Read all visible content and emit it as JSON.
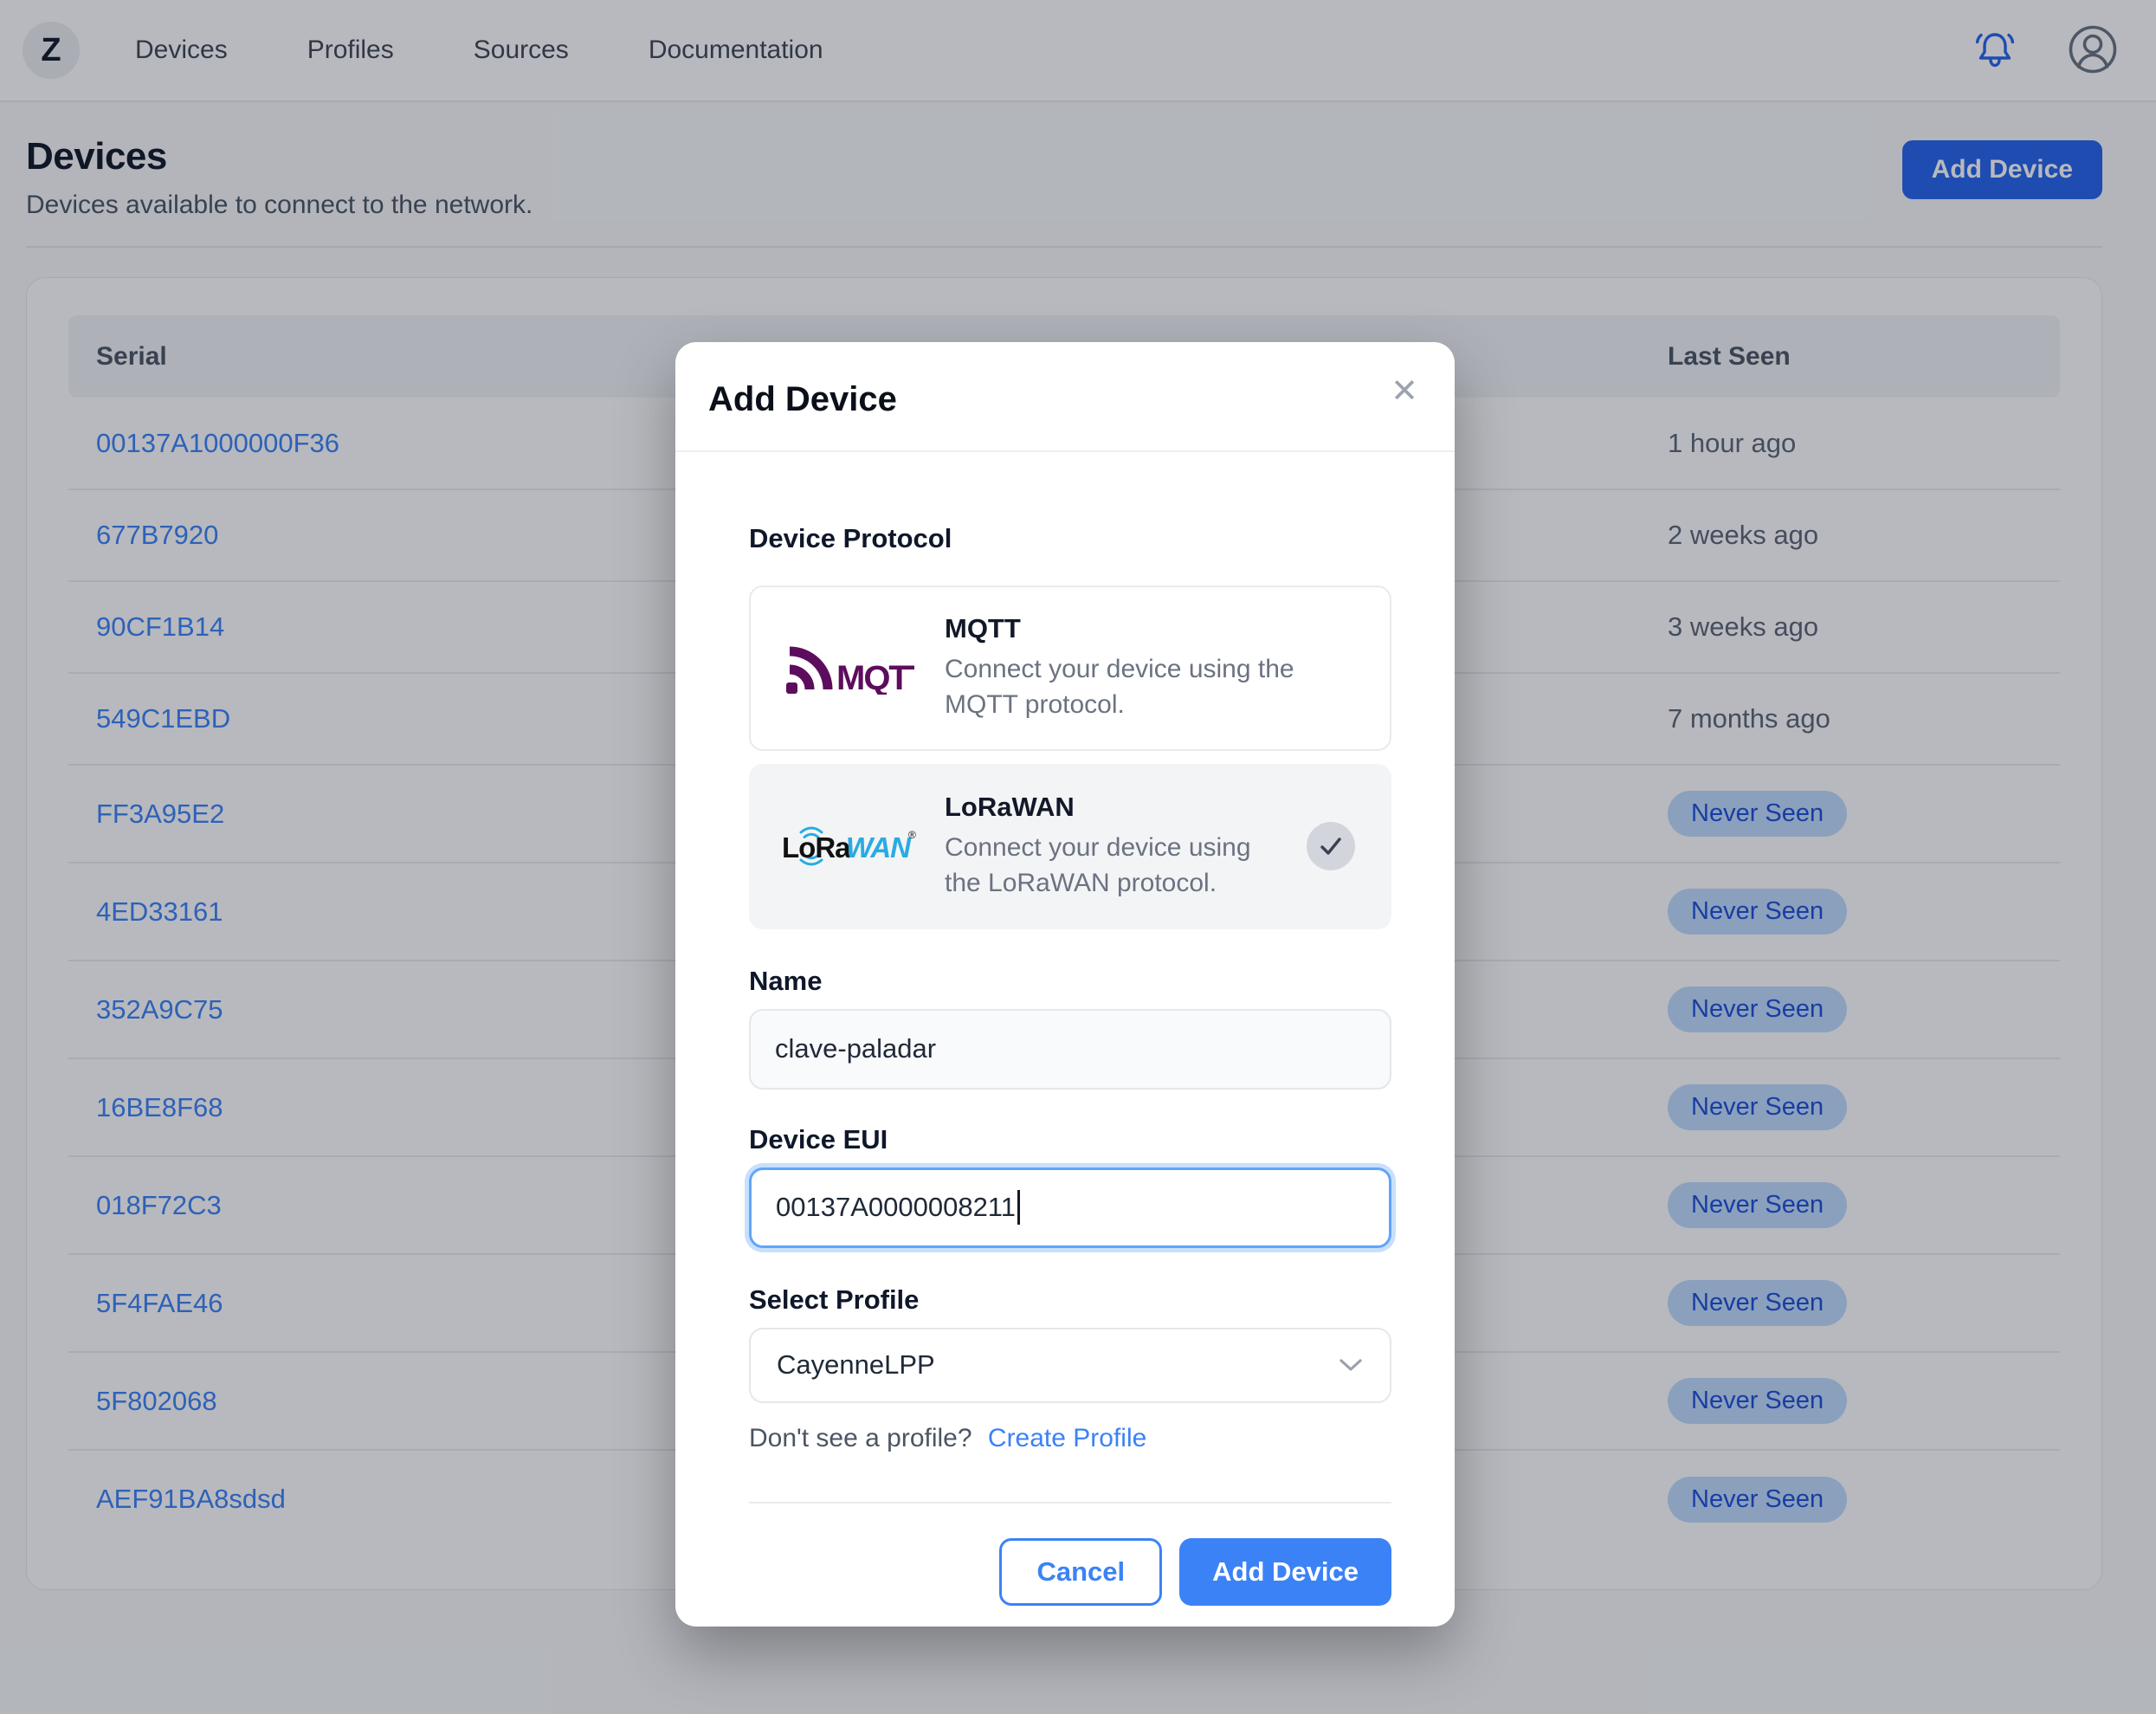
{
  "nav": {
    "logo": "Z",
    "items": [
      {
        "label": "Devices"
      },
      {
        "label": "Profiles"
      },
      {
        "label": "Sources"
      },
      {
        "label": "Documentation"
      }
    ],
    "icons": [
      "bell-icon",
      "user-avatar-icon"
    ]
  },
  "page": {
    "title": "Devices",
    "subtitle": "Devices available to connect to the network.",
    "add_device_button": "Add Device"
  },
  "table": {
    "columns": [
      "Serial",
      "Last Seen"
    ],
    "rows": [
      {
        "serial": "00137A1000000F36",
        "last_seen": "1 hour ago",
        "badge": false
      },
      {
        "serial": "677B7920",
        "last_seen": "2 weeks ago",
        "badge": false
      },
      {
        "serial": "90CF1B14",
        "last_seen": "3 weeks ago",
        "badge": false
      },
      {
        "serial": "549C1EBD",
        "last_seen": "7 months ago",
        "badge": false
      },
      {
        "serial": "FF3A95E2",
        "last_seen": "Never Seen",
        "badge": true
      },
      {
        "serial": "4ED33161",
        "last_seen": "Never Seen",
        "badge": true
      },
      {
        "serial": "352A9C75",
        "last_seen": "Never Seen",
        "badge": true
      },
      {
        "serial": "16BE8F68",
        "last_seen": "Never Seen",
        "badge": true
      },
      {
        "serial": "018F72C3",
        "last_seen": "Never Seen",
        "badge": true
      },
      {
        "serial": "5F4FAE46",
        "last_seen": "Never Seen",
        "badge": true
      },
      {
        "serial": "5F802068",
        "last_seen": "Never Seen",
        "badge": true
      },
      {
        "serial": "AEF91BA8sdsd",
        "last_seen": "Never Seen",
        "badge": true
      }
    ]
  },
  "modal": {
    "title": "Add Device",
    "close_icon": "✕",
    "protocol_label": "Device Protocol",
    "protocols": [
      {
        "name": "MQTT",
        "description": "Connect your device using the MQTT protocol.",
        "selected": false,
        "logo": "mqtt-logo"
      },
      {
        "name": "LoRaWAN",
        "description": "Connect your device using the LoRaWAN protocol.",
        "selected": true,
        "logo": "lorawan-logo"
      }
    ],
    "name_label": "Name",
    "name_value": "clave-paladar",
    "eui_label": "Device EUI",
    "eui_value": "00137A0000008211",
    "profile_label": "Select Profile",
    "profile_value": "CayenneLPP",
    "helper_text": "Don't see a profile?",
    "helper_link": "Create Profile",
    "cancel_button": "Cancel",
    "submit_button": "Add Device"
  },
  "colors": {
    "accent_blue": "#3b82f6",
    "header_button_blue": "#2563eb",
    "badge_bg": "#bfdbfe",
    "badge_text": "#1d4ed8",
    "mqtt_purple": "#5d0d5d",
    "lora_blue": "#29abe2",
    "overlay": "rgba(17,24,39,0.30)"
  }
}
